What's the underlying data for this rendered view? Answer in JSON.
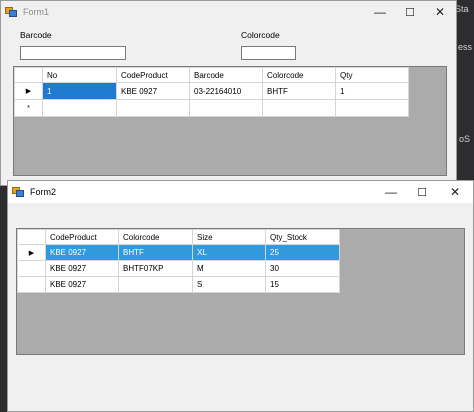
{
  "background": {
    "labels": [
      "Sta",
      "ess",
      "oS"
    ]
  },
  "form1": {
    "title": "Form1",
    "minimize": "—",
    "maximize": "☐",
    "close": "✕",
    "barcode_label": "Barcode",
    "barcode_value": "",
    "colorcode_label": "Colorcode",
    "colorcode_value": "",
    "grid": {
      "columns": [
        "No",
        "CodeProduct",
        "Barcode",
        "Colorcode",
        "Qty"
      ],
      "rows": [
        [
          "1",
          "KBE 0927",
          "03-22164010",
          "BHTF",
          "1"
        ]
      ],
      "current_row_marker": "▶",
      "new_row_marker": "*"
    }
  },
  "form2": {
    "title": "Form2",
    "minimize": "—",
    "maximize": "☐",
    "close": "✕",
    "grid": {
      "columns": [
        "CodeProduct",
        "Colorcode",
        "Size",
        "Qty_Stock"
      ],
      "rows": [
        [
          "KBE 0927",
          "BHTF",
          "XL",
          "25"
        ],
        [
          "KBE 0927",
          "BHTF07KP",
          "M",
          "30"
        ],
        [
          "KBE 0927",
          "",
          "S",
          "15"
        ]
      ],
      "current_row_marker": "▶"
    }
  }
}
